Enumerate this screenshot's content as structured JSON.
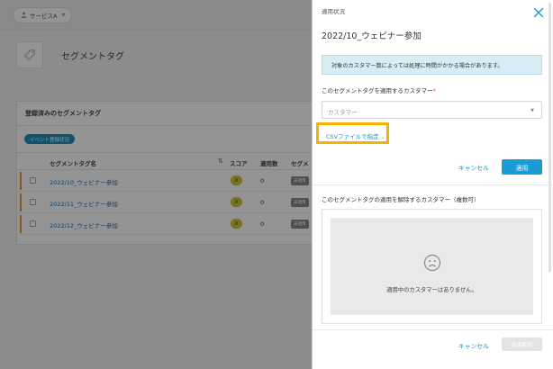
{
  "background": {
    "service_button": {
      "label": "サービスA",
      "icon": "user-icon"
    },
    "page_title": "セグメントタグ",
    "list_card": {
      "title": "登録済みのセグメントタグ",
      "event_button": "イベント登録状況",
      "headers": {
        "name": "セグメントタグ名",
        "score": "スコア",
        "count": "適用数",
        "segment": "セグメ"
      },
      "rows": [
        {
          "name": "2022/10_ウェビナー参加",
          "score": "0",
          "count": "0",
          "status": "未適用"
        },
        {
          "name": "2022/11_ウェビナー参加",
          "score": "0",
          "count": "0",
          "status": "未適用"
        },
        {
          "name": "2022/12_ウェビナー参加",
          "score": "0",
          "count": "0",
          "status": "未適用"
        }
      ]
    }
  },
  "drawer": {
    "header": "適用状況",
    "title": "2022/10_ウェビナー参加",
    "info": "対象のカスタマー数によっては処理に時間がかかる場合があります。",
    "apply_section": {
      "label": "このセグメントタグを適用するカスタマー",
      "required_mark": "*",
      "select_placeholder": "カスタマー",
      "csv_link": "CSVファイルで指定",
      "cancel": "キャンセル",
      "apply": "適用"
    },
    "remove_section": {
      "label": "このセグメントタグの適用を解除するカスタマー（複数可）",
      "empty_message": "適用中のカスタマーはありません。",
      "cancel": "キャンセル",
      "remove": "適用解除"
    }
  },
  "colors": {
    "accent": "#1b9bd6",
    "highlight": "#f5b300",
    "score_badge": "#c9c73a",
    "row_marker": "#e8943a"
  }
}
